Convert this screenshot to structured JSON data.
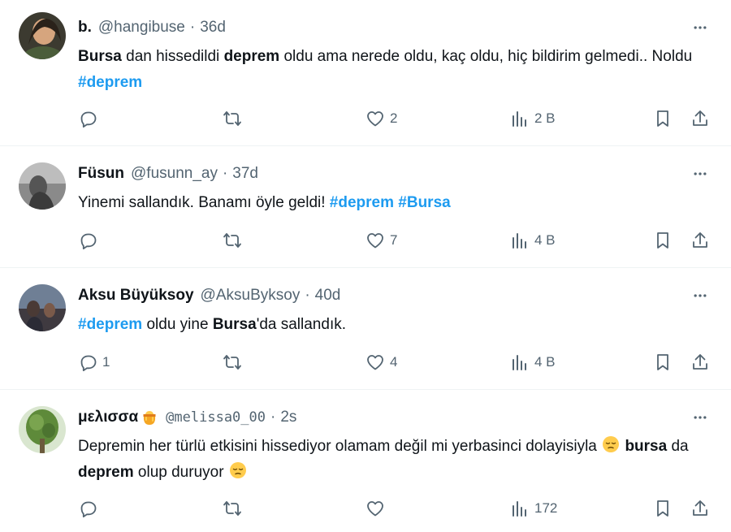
{
  "tweets": [
    {
      "name": "b.",
      "handle": "@hangibuse",
      "dot": "·",
      "time": "36d",
      "text": [
        {
          "t": "Bursa",
          "s": "b"
        },
        {
          "t": " dan hissedildi ",
          "s": ""
        },
        {
          "t": "deprem",
          "s": "b"
        },
        {
          "t": " oldu ama nerede oldu, kaç oldu, hiç bildirim gelmedi.. Noldu ",
          "s": ""
        },
        {
          "t": "#deprem",
          "s": "tag"
        }
      ],
      "replies": "",
      "reposts": "",
      "likes": "2",
      "views": "2 B"
    },
    {
      "name": "Füsun",
      "handle": "@fusunn_ay",
      "dot": "·",
      "time": "37d",
      "text": [
        {
          "t": "Yinemi sallandık. Banamı öyle geldi! ",
          "s": ""
        },
        {
          "t": "#deprem",
          "s": "tag"
        },
        {
          "t": " ",
          "s": ""
        },
        {
          "t": "#Bursa",
          "s": "tag"
        }
      ],
      "replies": "",
      "reposts": "",
      "likes": "7",
      "views": "4 B"
    },
    {
      "name": "Aksu Büyüksoy",
      "handle": "@AksuByksoy",
      "dot": "·",
      "time": "40d",
      "text": [
        {
          "t": "#deprem",
          "s": "tag"
        },
        {
          "t": " oldu yine ",
          "s": ""
        },
        {
          "t": "Bursa",
          "s": "b"
        },
        {
          "t": "'da sallandık.",
          "s": ""
        }
      ],
      "replies": "1",
      "reposts": "",
      "likes": "4",
      "views": "4 B"
    },
    {
      "name": "μελισσα",
      "name_emoji": "honeypot-emoji",
      "handle": "@melissa0_00",
      "dot": "·",
      "time": "2s",
      "text": [
        {
          "t": "Depremin her türlü etkisini hissediyor olamam değil mi yerbasinci dolayisiyla ",
          "s": ""
        },
        {
          "t": "pensive-face-emoji",
          "s": "emoji"
        },
        {
          "t": " ",
          "s": ""
        },
        {
          "t": "bursa",
          "s": "b"
        },
        {
          "t": " da ",
          "s": ""
        },
        {
          "t": "deprem",
          "s": "b"
        },
        {
          "t": " olup duruyor ",
          "s": ""
        },
        {
          "t": "pensive-face-emoji",
          "s": "emoji"
        }
      ],
      "replies": "",
      "reposts": "",
      "likes": "",
      "views": "172"
    }
  ],
  "icons": {
    "more": "more-icon",
    "reply": "reply-icon",
    "repost": "repost-icon",
    "like": "like-icon",
    "views": "views-icon",
    "bookmark": "bookmark-icon",
    "share": "share-icon"
  },
  "colors": {
    "text": "#0f1419",
    "secondary": "#536471",
    "link": "#1d9bf0",
    "divider": "#eff3f4"
  }
}
